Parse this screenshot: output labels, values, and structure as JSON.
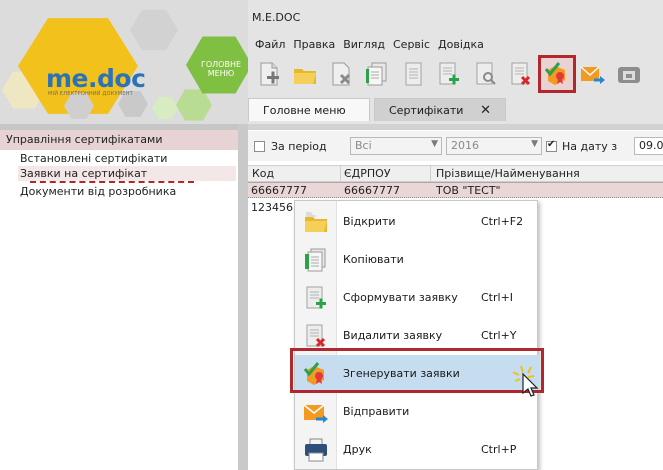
{
  "window": {
    "title": "M.E.DOC"
  },
  "logo": {
    "brand": "me.doc",
    "tagline": "МІЙ ЕЛЕКТРОННИЙ ДОКУМЕНТ",
    "main_menu_badge": "ГОЛОВНЕ МЕНЮ"
  },
  "menubar": {
    "items": [
      "Файл",
      "Правка",
      "Вигляд",
      "Сервіс",
      "Довідка"
    ]
  },
  "toolbar": {
    "buttons": [
      {
        "icon": "new-document-icon"
      },
      {
        "icon": "open-folder-icon"
      },
      {
        "icon": "delete-document-icon"
      },
      {
        "icon": "copy-document-icon"
      },
      {
        "icon": "document-icon"
      },
      {
        "icon": "create-request-icon"
      },
      {
        "icon": "document-search-icon"
      },
      {
        "icon": "delete-request-icon"
      },
      {
        "icon": "generate-requests-icon",
        "active": true
      },
      {
        "icon": "send-envelope-icon"
      },
      {
        "icon": "print-icon"
      }
    ]
  },
  "tabs": [
    {
      "label": "Головне меню"
    },
    {
      "label": "Сертифікати",
      "close": "✕"
    }
  ],
  "sidebar": {
    "header": "Управління сертифікатами",
    "items": [
      {
        "label": "Встановлені сертифікати"
      },
      {
        "label": "Заявки на сертифікат",
        "selected": true
      },
      {
        "label": "Документи від розробника"
      }
    ]
  },
  "filters": {
    "period_label": "За період",
    "period_checked": false,
    "period_value": "Всі",
    "year_value": "2016",
    "on_date_label": "На дату з",
    "on_date_checked": true,
    "date_value": "09.0"
  },
  "grid": {
    "columns": [
      "Код",
      "ЄДРПОУ",
      "Прізвище/Найменування"
    ],
    "rows": [
      {
        "code": "66667777",
        "edrpou": "66667777",
        "name": "ТОВ \"ТЕСТ\"",
        "selected": true
      },
      {
        "code": "123456",
        "edrpou": "",
        "name": ""
      }
    ]
  },
  "context_menu": {
    "items": [
      {
        "label": "Відкрити",
        "shortcut": "Ctrl+F2",
        "icon": "open-folder-icon"
      },
      {
        "label": "Копіювати",
        "shortcut": "",
        "icon": "copy-document-icon"
      },
      {
        "label": "Сформувати заявку",
        "shortcut": "Ctrl+I",
        "icon": "create-request-icon"
      },
      {
        "label": "Видалити заявку",
        "shortcut": "Ctrl+Y",
        "icon": "delete-request-icon"
      },
      {
        "label": "Згенерувати заявки",
        "shortcut": "",
        "icon": "generate-requests-icon",
        "highlighted": true
      },
      {
        "label": "Відправити",
        "shortcut": "",
        "icon": "send-envelope-icon"
      },
      {
        "label": "Друк",
        "shortcut": "Ctrl+P",
        "icon": "print-icon"
      }
    ]
  },
  "colors": {
    "accent_red": "#b0272e",
    "logo_yellow": "#f2c11b",
    "logo_green": "#7fc043",
    "brand_blue": "#2b73b8",
    "highlight_blue": "#c6dcef"
  }
}
